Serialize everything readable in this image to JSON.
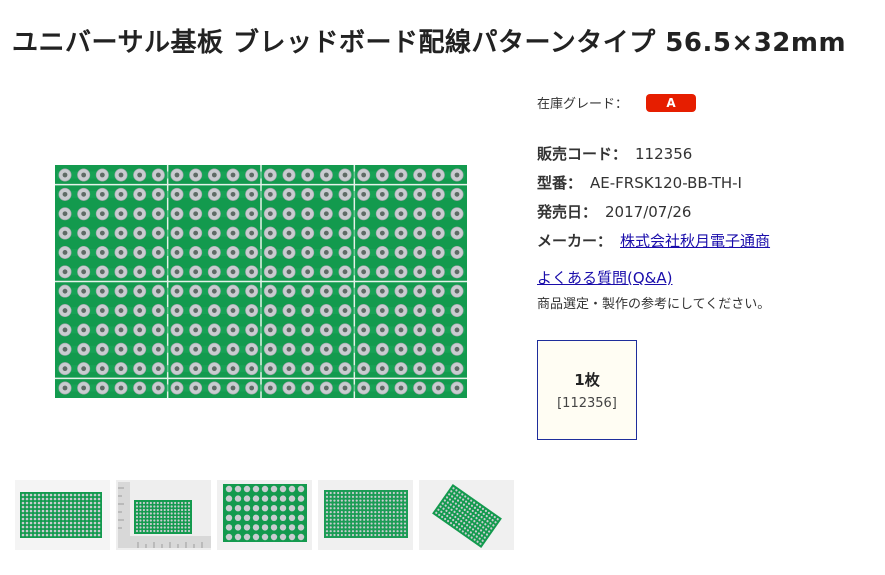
{
  "product": {
    "title": "ユニバーサル基板 ブレッドボード配線パターンタイプ 56.5×32mm"
  },
  "stock": {
    "label": "在庫グレード：",
    "grade": "A",
    "grade_color": "#e61e00"
  },
  "specs": {
    "code_label": "販売コード：",
    "code_value": "112356",
    "model_label": "型番：",
    "model_value": "AE-FRSK120-BB-TH-I",
    "release_label": "発売日：",
    "release_value": "2017/07/26",
    "maker_label": "メーカー：",
    "maker_value": "株式会社秋月電子通商"
  },
  "faq": {
    "link_text": "よくある質問(Q&A)",
    "note": "商品選定・製作の参考にしてください。"
  },
  "variant": {
    "quantity": "1枚",
    "code": "[112356]"
  },
  "images": {
    "main_icon": "pcb-board-image",
    "thumbnails": [
      "pcb-front",
      "pcb-with-ruler",
      "pcb-closeup",
      "pcb-back",
      "pcb-angled"
    ]
  },
  "colors": {
    "pcb_green": "#139a4e",
    "link": "#1a0dab",
    "variant_border": "#1e2d9b"
  }
}
